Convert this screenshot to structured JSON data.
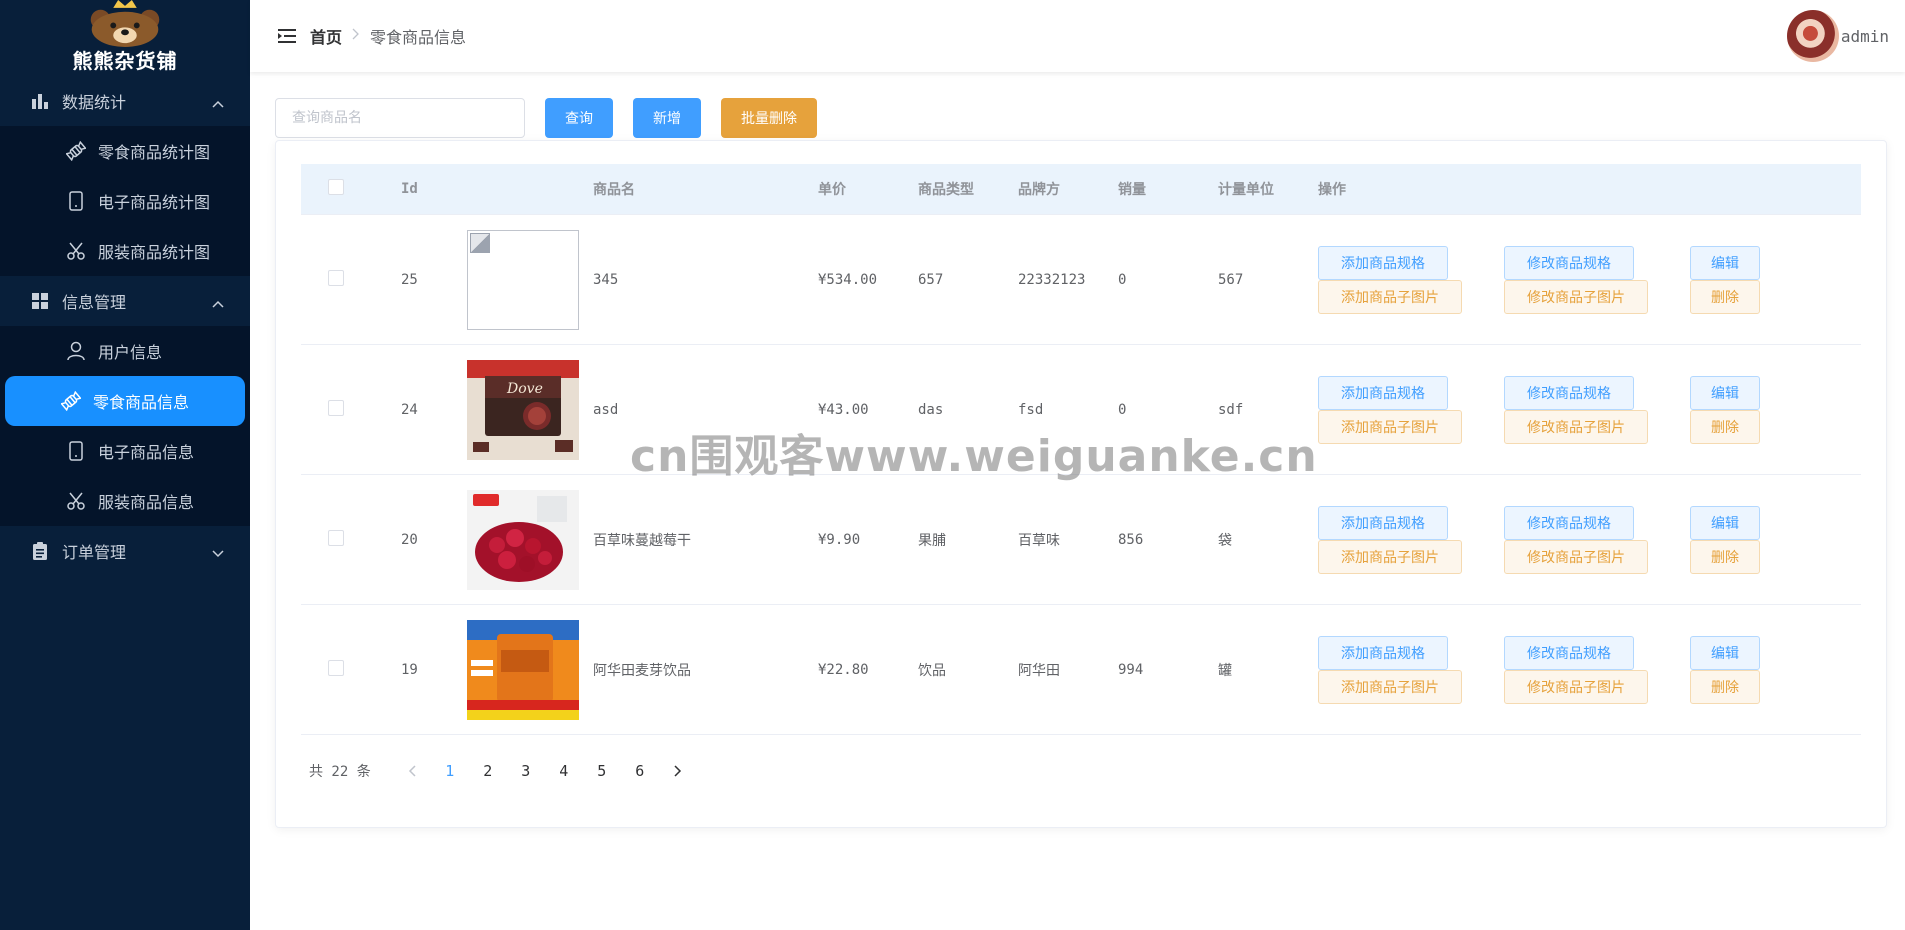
{
  "sidebar": {
    "logo_text": "熊熊杂货铺",
    "groups": [
      {
        "label": "数据统计",
        "icon": "bar-chart-icon",
        "expanded": true,
        "items": [
          {
            "label": "零食商品统计图",
            "icon": "candy-icon"
          },
          {
            "label": "电子商品统计图",
            "icon": "tablet-icon"
          },
          {
            "label": "服装商品统计图",
            "icon": "scissors-icon"
          }
        ]
      },
      {
        "label": "信息管理",
        "icon": "grid-icon",
        "expanded": true,
        "items": [
          {
            "label": "用户信息",
            "icon": "user-icon"
          },
          {
            "label": "零食商品信息",
            "icon": "candy-icon",
            "active": true
          },
          {
            "label": "电子商品信息",
            "icon": "tablet-icon"
          },
          {
            "label": "服装商品信息",
            "icon": "scissors-icon"
          }
        ]
      },
      {
        "label": "订单管理",
        "icon": "clipboard-icon",
        "expanded": false,
        "items": []
      }
    ]
  },
  "header": {
    "breadcrumb_home": "首页",
    "breadcrumb_current": "零食商品信息",
    "user_name": "admin"
  },
  "toolbar": {
    "search_placeholder": "查询商品名",
    "query_label": "查询",
    "add_label": "新增",
    "batch_delete_label": "批量删除"
  },
  "table": {
    "headers": {
      "id": "Id",
      "name": "商品名",
      "price": "单价",
      "type": "商品类型",
      "brand": "品牌方",
      "sales": "销量",
      "unit": "计量单位",
      "ops": "操作"
    },
    "rows": [
      {
        "id": "25",
        "name": "345",
        "price": "¥534.00",
        "type": "657",
        "brand": "22332123",
        "sales": "0",
        "unit": "567",
        "image": "none"
      },
      {
        "id": "24",
        "name": "asd",
        "price": "¥43.00",
        "type": "das",
        "brand": "fsd",
        "sales": "0",
        "unit": "sdf",
        "image": "dove-chocolate"
      },
      {
        "id": "20",
        "name": "百草味蔓越莓干",
        "price": "¥9.90",
        "type": "果脯",
        "brand": "百草味",
        "sales": "856",
        "unit": "袋",
        "image": "cranberries"
      },
      {
        "id": "19",
        "name": "阿华田麦芽饮品",
        "price": "¥22.80",
        "type": "饮品",
        "brand": "阿华田",
        "sales": "994",
        "unit": "罐",
        "image": "ovaltine-can"
      }
    ],
    "ops": {
      "add_spec": "添加商品规格",
      "add_sub_img": "添加商品子图片",
      "edit_spec": "修改商品规格",
      "edit_sub_img": "修改商品子图片",
      "edit": "编辑",
      "delete": "删除"
    }
  },
  "pagination": {
    "total_text": "共 22 条",
    "pages": [
      "1",
      "2",
      "3",
      "4",
      "5",
      "6"
    ],
    "current": "1"
  },
  "watermark": "cn围观客www.weiguanke.cn",
  "colors": {
    "sidebar_bg": "#081f3a",
    "active_item": "#1890ff",
    "primary": "#409eff",
    "warning": "#e6a23c"
  }
}
